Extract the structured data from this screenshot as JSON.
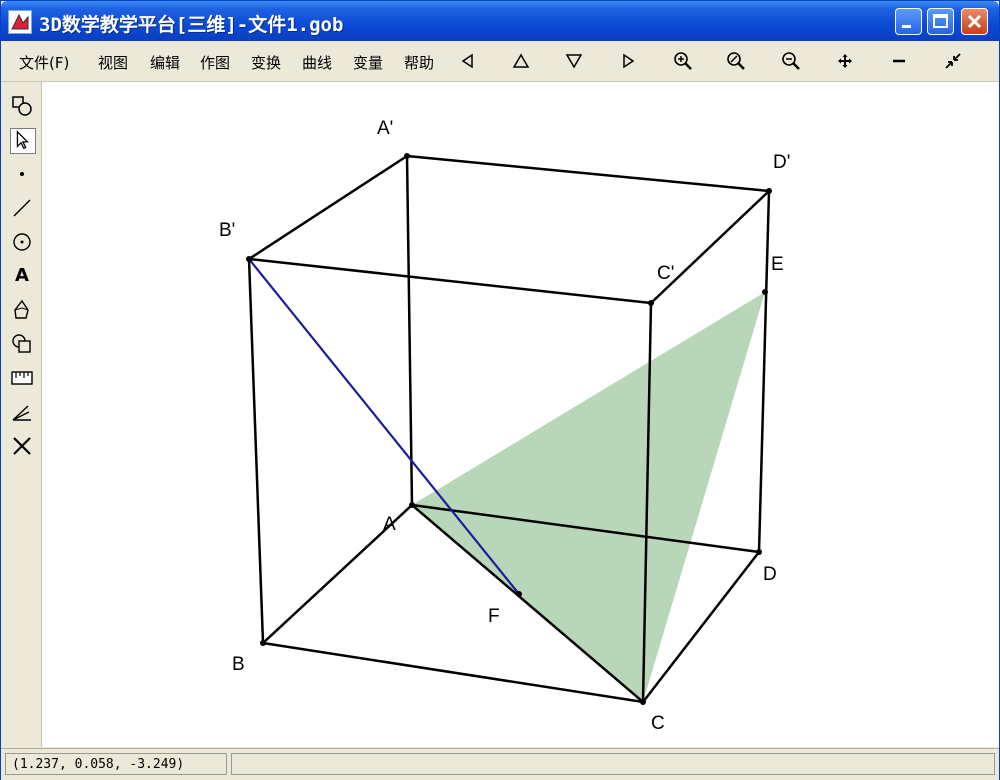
{
  "window": {
    "title": "3D数学教学平台[三维]-文件1.gob"
  },
  "menu": {
    "items": [
      "文件(F)",
      "视图",
      "编辑",
      "作图",
      "变换",
      "曲线",
      "变量",
      "帮助"
    ]
  },
  "toolbar": {
    "icons": [
      "triangle-left-icon",
      "triangle-up-icon",
      "triangle-down-icon",
      "triangle-right-icon",
      "zoom-in-icon",
      "zoom-rotate-icon",
      "zoom-out-icon",
      "move-icon",
      "minus-icon",
      "collapse-icon"
    ]
  },
  "tools": {
    "icons": [
      "shapes-tool-icon",
      "pointer-tool-icon",
      "point-tool-icon",
      "line-tool-icon",
      "circle-tool-icon",
      "text-tool-icon",
      "polygon-tool-icon",
      "solid-tool-icon",
      "measure-tool-icon",
      "angle-tool-icon",
      "delete-tool-icon"
    ],
    "text_tool_glyph": "A"
  },
  "figure": {
    "labels": {
      "A_prime": "A'",
      "B_prime": "B'",
      "C_prime": "C'",
      "D_prime": "D'",
      "E": "E",
      "A": "A",
      "B": "B",
      "C": "C",
      "D": "D",
      "F": "F"
    },
    "colors": {
      "edge": "#000000",
      "diagonal": "#1c1c9c",
      "face_fill": "#b8d6b8"
    }
  },
  "status": {
    "coordinates": "(1.237, 0.058, -3.249)"
  },
  "colors": {
    "titlebar": "#0b4ad6",
    "chrome": "#ece9d8"
  }
}
